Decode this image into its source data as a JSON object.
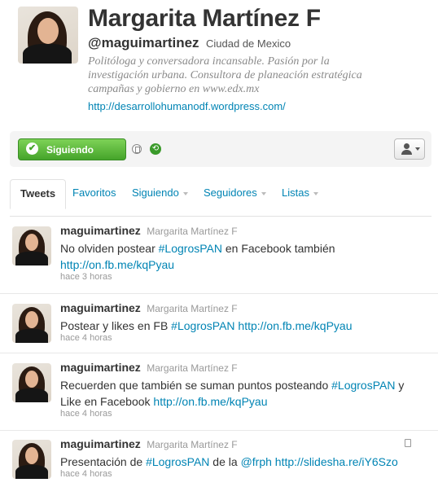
{
  "profile": {
    "name": "Margarita Martínez F",
    "screen_name": "@maguimartinez",
    "location": "Ciudad de Mexico",
    "bio": "Politóloga y conversadora incansable. Pasión por la investigación urbana. Consultora de planeación estratégica campañas y gobierno en www.edx.mx",
    "url": "http://desarrollohumanodf.wordpress.com/"
  },
  "actions": {
    "follow_label": "Siguiendo",
    "follow_icon": "check-icon",
    "device_icon": "device-icon",
    "retweet_icon": "retweet-icon",
    "user_menu_icon": "person-icon"
  },
  "tabs": [
    {
      "label": "Tweets",
      "active": true
    },
    {
      "label": "Favoritos"
    },
    {
      "label": "Siguiendo",
      "dropdown": true
    },
    {
      "label": "Seguidores",
      "dropdown": true
    },
    {
      "label": "Listas",
      "dropdown": true
    }
  ],
  "tweets": [
    {
      "screen_name": "maguimartinez",
      "full_name": "Margarita Martínez F",
      "parts": [
        "No olviden postear ",
        "#LogrosPAN",
        " en Facebook también ",
        "http://on.fb.me/kqPyau"
      ],
      "time": "hace 3 horas"
    },
    {
      "screen_name": "maguimartinez",
      "full_name": "Margarita Martínez F",
      "parts": [
        "Postear y likes en FB ",
        "#LogrosPAN",
        " ",
        "http://on.fb.me/kqPyau"
      ],
      "time": "hace 4 horas"
    },
    {
      "screen_name": "maguimartinez",
      "full_name": "Margarita Martínez F",
      "parts": [
        "Recuerden que también se suman puntos posteando ",
        "#LogrosPAN",
        " y Like en Facebook ",
        "http://on.fb.me/kqPyau"
      ],
      "time": "hace 4 horas"
    },
    {
      "screen_name": "maguimartinez",
      "full_name": "Margarita Martínez F",
      "parts": [
        "Presentación de ",
        "#LogrosPAN",
        " de la ",
        "@frph",
        " ",
        "http://slidesha.re/iY6Szo"
      ],
      "time": "hace 4 horas"
    }
  ],
  "colors": {
    "link": "#0084b4",
    "follow_green": "#45a42a"
  }
}
